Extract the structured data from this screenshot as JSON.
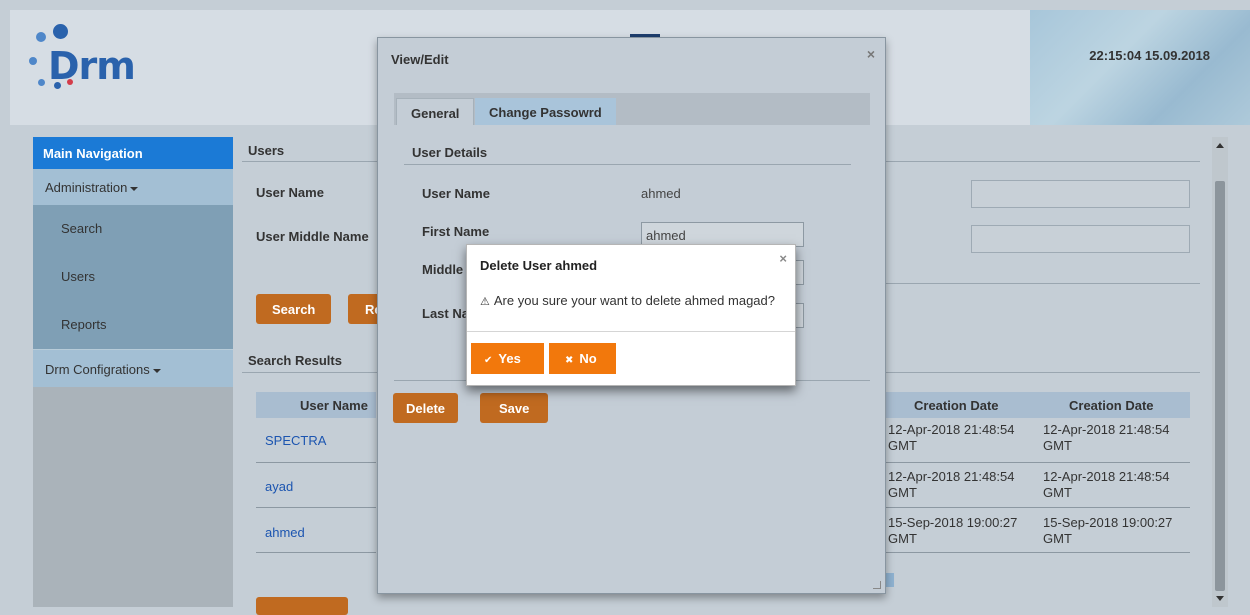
{
  "header": {
    "logo_text": "Drm",
    "clock": "22:15:04 15.09.2018"
  },
  "sidebar": {
    "title": "Main Navigation",
    "administration": "Administration",
    "items": [
      "Search",
      "Users",
      "Reports"
    ],
    "configurations": "Drm Configrations"
  },
  "users_form": {
    "section_title": "Users",
    "user_name_label": "User Name",
    "user_middle_name_label": "User Middle Name",
    "search_button": "Search",
    "reset_button_partial": "Re",
    "results_title": "Search Results"
  },
  "results_table": {
    "col_user_name": "User Name",
    "col_creation_date_1": "Creation Date",
    "col_creation_date_2": "Creation Date",
    "rows": [
      {
        "user": "SPECTRA",
        "date1": "12-Apr-2018 21:48:54",
        "tz1": "GMT",
        "date2": "12-Apr-2018 21:48:54",
        "tz2": "GMT"
      },
      {
        "user": "ayad",
        "date1": "12-Apr-2018 21:48:54",
        "tz1": "GMT",
        "date2": "12-Apr-2018 21:48:54",
        "tz2": "GMT"
      },
      {
        "user": "ahmed",
        "date1": "15-Sep-2018 19:00:27",
        "tz1": "GMT",
        "date2": "15-Sep-2018 19:00:27",
        "tz2": "GMT"
      }
    ]
  },
  "view_edit": {
    "title": "View/Edit",
    "close": "×",
    "tab_general": "General",
    "tab_change_password": "Change Passowrd",
    "section": "User Details",
    "user_name_label": "User Name",
    "user_name_value": "ahmed",
    "first_name_label": "First Name",
    "first_name_value": "ahmed",
    "middle_label_partial": "Middle",
    "last_label_partial": "Last Na",
    "delete_button": "Delete",
    "save_button": "Save"
  },
  "dialog": {
    "title": "Delete User ahmed",
    "close": "×",
    "warning_icon": "⚠",
    "message": "Are you sure your want to delete ahmed magad?",
    "yes_icon": "✔",
    "yes_label": "Yes",
    "no_icon": "✖",
    "no_label": "No"
  },
  "colors": {
    "nav_header": "#1b7ad6",
    "button": "#c06a20",
    "dialog_button": "#f2780c",
    "link": "#1c55b0"
  }
}
